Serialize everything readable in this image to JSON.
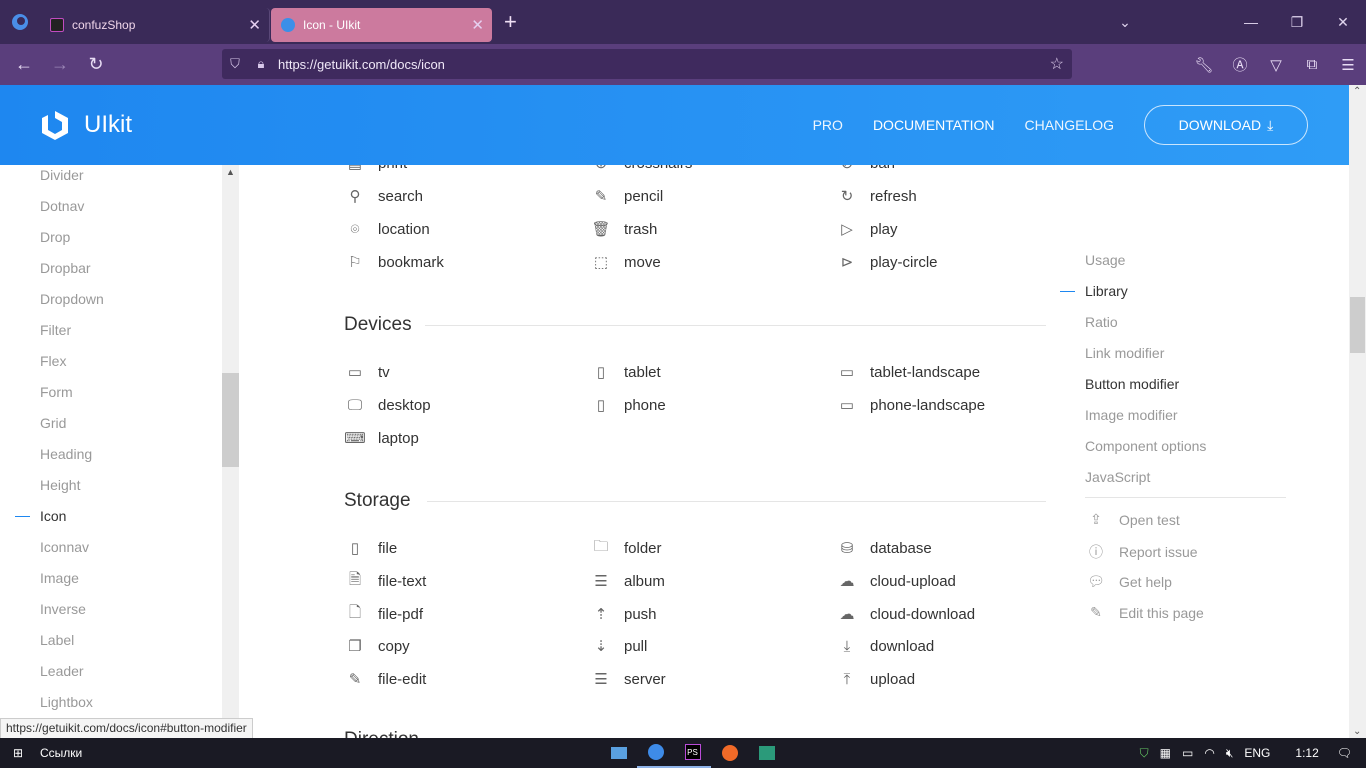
{
  "browser": {
    "tabs": [
      {
        "title": "confuzShop",
        "active": false
      },
      {
        "title": "Icon - UIkit",
        "active": true
      }
    ],
    "url": "https://getuikit.com/docs/icon",
    "status_url": "https://getuikit.com/docs/icon#button-modifier"
  },
  "header": {
    "logo_text": "UIkit",
    "nav": [
      "PRO",
      "DOCUMENTATION",
      "CHANGELOG"
    ],
    "download_label": "DOWNLOAD"
  },
  "sidebar": {
    "items": [
      "Divider",
      "Dotnav",
      "Drop",
      "Dropbar",
      "Dropdown",
      "Filter",
      "Flex",
      "Form",
      "Grid",
      "Heading",
      "Height",
      "Icon",
      "Iconnav",
      "Image",
      "Inverse",
      "Label",
      "Leader",
      "Lightbox"
    ],
    "active": "Icon"
  },
  "content": {
    "top_partial": [
      "print",
      "crosshairs",
      "ban"
    ],
    "top_rows": [
      [
        "search",
        "pencil",
        "refresh"
      ],
      [
        "location",
        "trash",
        "play"
      ],
      [
        "bookmark",
        "move",
        "play-circle"
      ]
    ],
    "devices_title": "Devices",
    "devices": [
      [
        "tv",
        "tablet",
        "tablet-landscape"
      ],
      [
        "desktop",
        "phone",
        "phone-landscape"
      ],
      [
        "laptop",
        "",
        ""
      ]
    ],
    "storage_title": "Storage",
    "storage": [
      [
        "file",
        "folder",
        "database"
      ],
      [
        "file-text",
        "album",
        "cloud-upload"
      ],
      [
        "file-pdf",
        "push",
        "cloud-download"
      ],
      [
        "copy",
        "pull",
        "download"
      ],
      [
        "file-edit",
        "server",
        "upload"
      ]
    ],
    "next_partial": "Direction"
  },
  "toc": {
    "items": [
      "Usage",
      "Library",
      "Ratio",
      "Link modifier",
      "Button modifier",
      "Image modifier",
      "Component options",
      "JavaScript"
    ],
    "active": "Library",
    "links": [
      "Open test",
      "Report issue",
      "Get help",
      "Edit this page"
    ]
  },
  "taskbar": {
    "links_label": "Ссылки",
    "lang": "ENG",
    "time": "1:12"
  },
  "colors": {
    "accent": "#1e87f0",
    "tab_active": "#cc7a9e",
    "browser_bg": "#3a2a58"
  }
}
